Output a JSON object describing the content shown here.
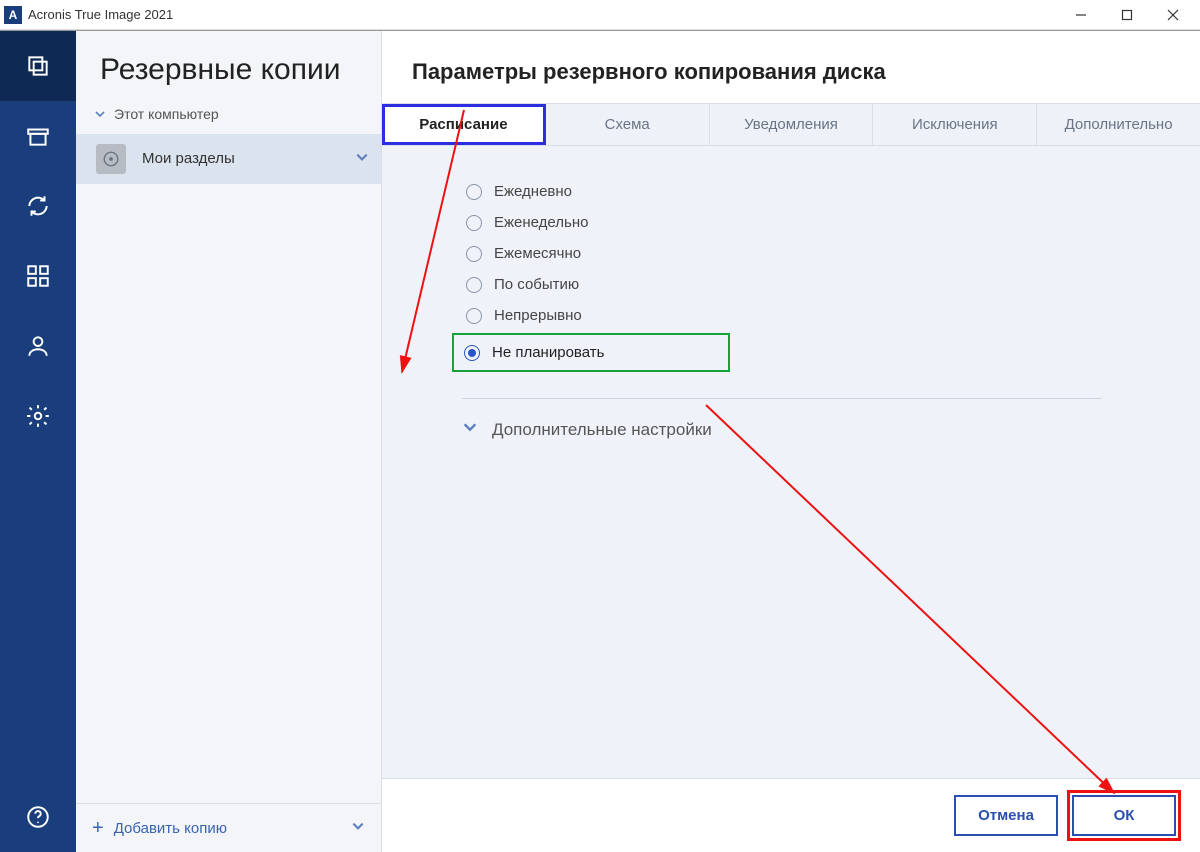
{
  "window": {
    "title": "Acronis True Image 2021",
    "logo_letter": "A"
  },
  "sidebar": {
    "heading": "Резервные копии",
    "tree_root": "Этот компьютер",
    "item_label": "Мои разделы",
    "add_label": "Добавить копию"
  },
  "main": {
    "title": "Параметры резервного копирования диска",
    "tabs": [
      "Расписание",
      "Схема",
      "Уведомления",
      "Исключения",
      "Дополнительно"
    ],
    "selected_tab_index": 0,
    "schedule_options": [
      "Ежедневно",
      "Еженедельно",
      "Ежемесячно",
      "По событию",
      "Непрерывно",
      "Не планировать"
    ],
    "selected_option_index": 5,
    "advanced_label": "Дополнительные настройки",
    "buttons": {
      "cancel": "Отмена",
      "ok": "ОК"
    }
  },
  "colors": {
    "brand": "#1a3e7b",
    "accent": "#2a55c7",
    "hl_blue": "#2a2ee0",
    "hl_green": "#17a23a",
    "hl_red": "#e11"
  }
}
